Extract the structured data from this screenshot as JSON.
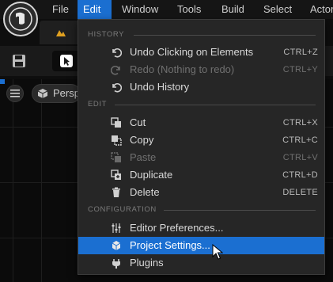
{
  "menubar": {
    "items": [
      {
        "label": "File"
      },
      {
        "label": "Edit"
      },
      {
        "label": "Window"
      },
      {
        "label": "Tools"
      },
      {
        "label": "Build"
      },
      {
        "label": "Select"
      },
      {
        "label": "Actor"
      }
    ],
    "active": "Edit"
  },
  "viewport": {
    "perspective_label": "Perspective"
  },
  "edit_menu": {
    "sections": {
      "history": "HISTORY",
      "edit": "EDIT",
      "configuration": "CONFIGURATION"
    },
    "items": [
      {
        "label": "Undo Clicking on Elements",
        "shortcut": "CTRL+Z",
        "icon": "undo-icon",
        "enabled": true
      },
      {
        "label": "Redo (Nothing to redo)",
        "shortcut": "CTRL+Y",
        "icon": "redo-icon",
        "enabled": false
      },
      {
        "label": "Undo History",
        "shortcut": "",
        "icon": "history-icon",
        "enabled": true
      },
      {
        "label": "Cut",
        "shortcut": "CTRL+X",
        "icon": "cut-icon",
        "enabled": true
      },
      {
        "label": "Copy",
        "shortcut": "CTRL+C",
        "icon": "copy-icon",
        "enabled": true
      },
      {
        "label": "Paste",
        "shortcut": "CTRL+V",
        "icon": "paste-icon",
        "enabled": false
      },
      {
        "label": "Duplicate",
        "shortcut": "CTRL+D",
        "icon": "duplicate-icon",
        "enabled": true
      },
      {
        "label": "Delete",
        "shortcut": "DELETE",
        "icon": "trash-icon",
        "enabled": true
      },
      {
        "label": "Editor Preferences...",
        "shortcut": "",
        "icon": "sliders-icon",
        "enabled": true
      },
      {
        "label": "Project Settings...",
        "shortcut": "",
        "icon": "project-settings-icon",
        "enabled": true,
        "highlighted": true
      },
      {
        "label": "Plugins",
        "shortcut": "",
        "icon": "plugins-icon",
        "enabled": true
      }
    ]
  },
  "colors": {
    "accent": "#1b6fd1",
    "menu_bg": "#262626",
    "text": "#d9d9d9",
    "disabled_text": "#707070"
  }
}
